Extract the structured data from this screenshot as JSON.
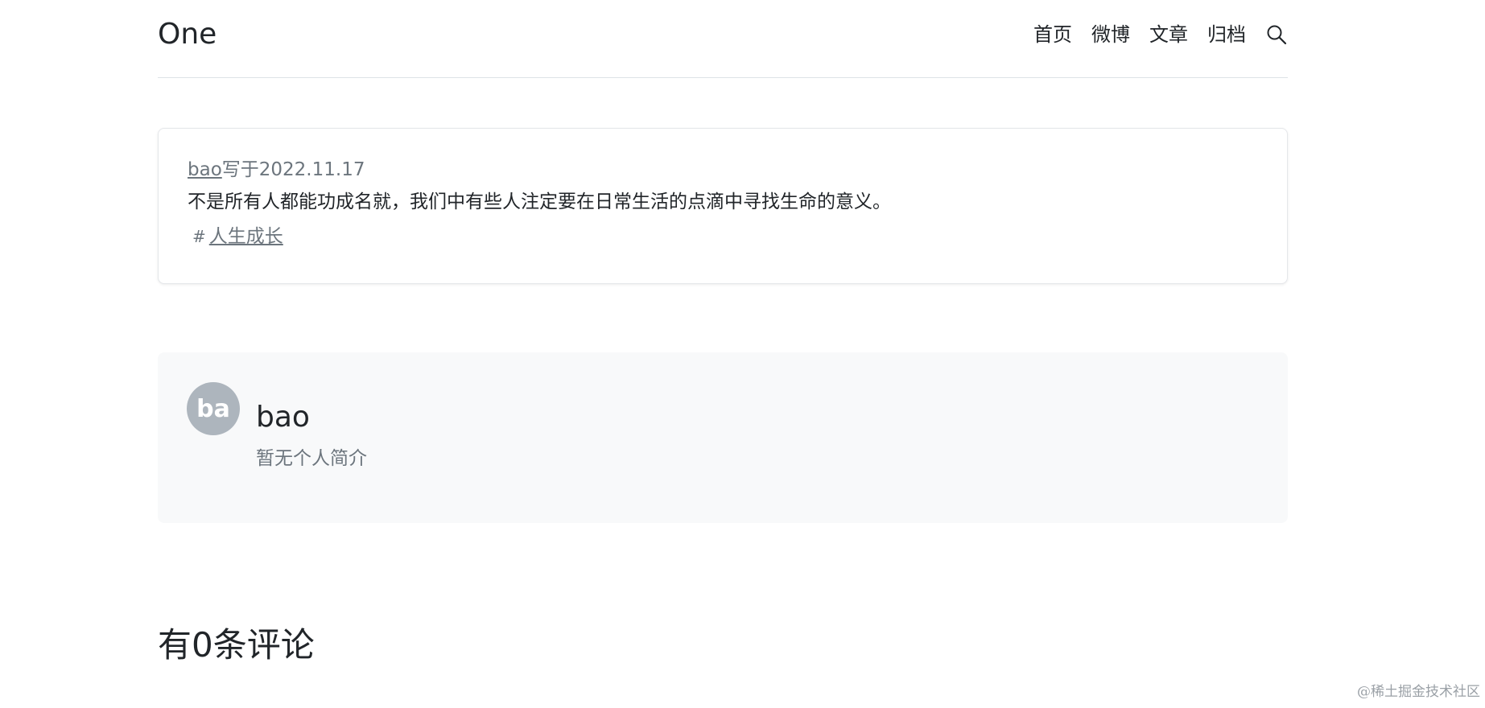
{
  "header": {
    "brand": "One",
    "nav": [
      "首页",
      "微博",
      "文章",
      "归档"
    ]
  },
  "post": {
    "author": "bao",
    "written_on": "写于2022.11.17",
    "content": "不是所有人都能功成名就，我们中有些人注定要在日常生活的点滴中寻找生命的意义。",
    "tag_hash": "#",
    "tag": "人生成长"
  },
  "author_card": {
    "avatar_initials": "ba",
    "name": "bao",
    "bio": "暂无个人简介"
  },
  "comments": {
    "title": "有0条评论"
  },
  "watermark": "@稀土掘金技术社区",
  "colors": {
    "text": "#212529",
    "muted": "#6c757d",
    "avatar_bg": "#adb5bd",
    "card_bg": "#f8f9fa"
  }
}
